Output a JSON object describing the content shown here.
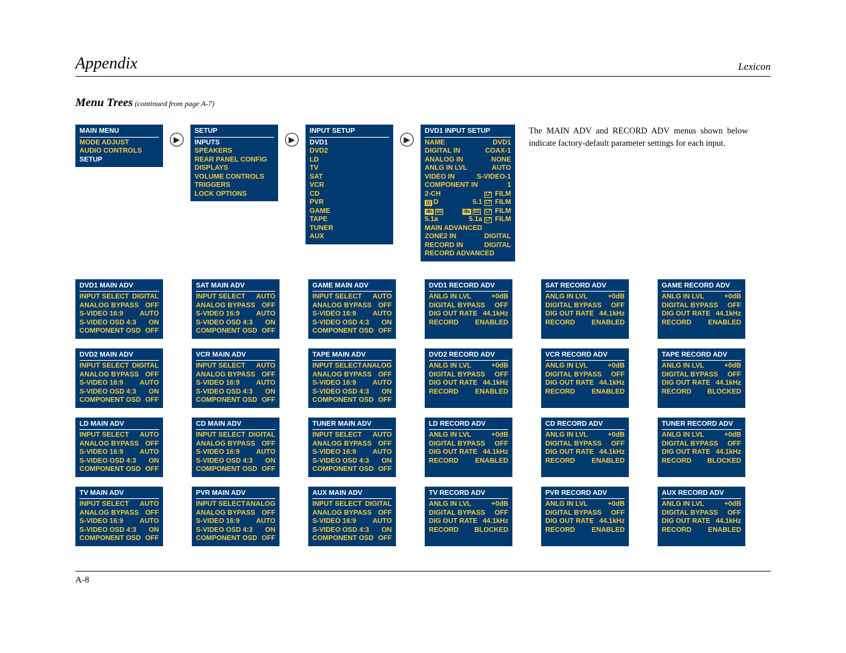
{
  "header": {
    "left": "Appendix",
    "right": "Lexicon",
    "footer": "A-8"
  },
  "subtitle": {
    "main": "Menu Trees",
    "note": "(continued from page A-7)"
  },
  "description": "The MAIN ADV and RECORD ADV menus shown below indicate factory-default parameter settings for each input.",
  "top_boxes": {
    "main_menu": {
      "title": "MAIN MENU",
      "items": [
        "MODE ADJUST",
        "AUDIO CONTROLS"
      ],
      "hdr_items": [
        "SETUP"
      ]
    },
    "setup": {
      "title": "SETUP",
      "items": [
        "SPEAKERS",
        "REAR PANEL CONFIG",
        "DISPLAYS",
        "VOLUME CONTROLS",
        "TRIGGERS",
        "LOCK OPTIONS"
      ],
      "hdr_items": [
        "INPUTS"
      ]
    },
    "input_setup": {
      "title": "INPUT SETUP",
      "items": [
        "DVD2",
        "LD",
        "TV",
        "SAT",
        "VCR",
        "CD",
        "PVR",
        "GAME",
        "TAPE",
        "TUNER",
        "AUX"
      ],
      "hdr_items": [
        "DVD1"
      ]
    },
    "dvd1_input": {
      "title": "DVD1 INPUT SETUP",
      "rows": [
        {
          "l": "NAME",
          "r": "DVD1"
        },
        {
          "l": "DIGITAL IN",
          "r": "COAX-1"
        },
        {
          "l": "ANALOG IN",
          "r": "NONE"
        },
        {
          "l": "ANLG IN LVL",
          "r": "AUTO"
        },
        {
          "l": "VIDEO IN",
          "r": "S-VIDEO-1"
        },
        {
          "l": "COMPONENT IN",
          "r": "1"
        },
        {
          "l": "2-CH",
          "r": "L7 FILM",
          "badge": "L7"
        },
        {
          "l": "DD",
          "r": "5.1 L7 FILM",
          "lbadge": "DD",
          "badge": "L7"
        },
        {
          "l": "dts",
          "r": "dts-ES L7 FILM",
          "lbadge": "dts",
          "badge": "L7"
        },
        {
          "l": "5.1a",
          "r": "5.1a L7 FILM",
          "badge": "L7"
        },
        {
          "l": "MAIN ADVANCED",
          "r": ""
        },
        {
          "l": "ZONE2 IN",
          "r": "DIGITAL"
        },
        {
          "l": "RECORD IN",
          "r": "DIGITAL"
        },
        {
          "l": "RECORD ADVANCED",
          "r": ""
        }
      ]
    }
  },
  "main_adv_rows": [
    {
      "l": "INPUT SELECT",
      "v": [
        "DIGITAL",
        "AUTO",
        "AUTO",
        "DIGITAL",
        "AUTO",
        "ANALOG",
        "AUTO",
        "DIGITAL",
        "AUTO",
        "AUTO",
        "ANALOG",
        "DIGITAL"
      ]
    },
    {
      "l": "ANALOG BYPASS",
      "v": [
        "OFF",
        "OFF",
        "OFF",
        "OFF",
        "OFF",
        "OFF",
        "OFF",
        "OFF",
        "OFF",
        "OFF",
        "OFF",
        "OFF"
      ]
    },
    {
      "l": "S-VIDEO 16:9",
      "v": [
        "AUTO",
        "AUTO",
        "AUTO",
        "AUTO",
        "AUTO",
        "AUTO",
        "AUTO",
        "AUTO",
        "AUTO",
        "AUTO",
        "AUTO",
        "AUTO"
      ]
    },
    {
      "l": "S-VIDEO OSD 4:3",
      "v": [
        "ON",
        "ON",
        "ON",
        "ON",
        "ON",
        "ON",
        "ON",
        "ON",
        "ON",
        "ON",
        "ON",
        "ON"
      ]
    },
    {
      "l": "COMPONENT OSD",
      "v": [
        "OFF",
        "OFF",
        "OFF",
        "OFF",
        "OFF",
        "OFF",
        "OFF",
        "OFF",
        "OFF",
        "OFF",
        "OFF",
        "OFF"
      ]
    }
  ],
  "record_adv_rows": [
    {
      "l": "ANLG IN LVL",
      "v": [
        "+0dB",
        "+0dB",
        "+0dB",
        "+0dB",
        "+0dB",
        "+0dB",
        "+0dB",
        "+0dB",
        "+0dB",
        "+0dB",
        "+0dB",
        "+0dB"
      ]
    },
    {
      "l": "DIGITAL BYPASS",
      "v": [
        "OFF",
        "OFF",
        "OFF",
        "OFF",
        "OFF",
        "OFF",
        "OFF",
        "OFF",
        "OFF",
        "OFF",
        "OFF",
        "OFF"
      ]
    },
    {
      "l": "DIG OUT RATE",
      "v": [
        "44.1kHz",
        "44.1kHz",
        "44.1kHz",
        "44.1kHz",
        "44.1kHz",
        "44.1kHz",
        "44.1kHz",
        "44.1kHz",
        "44.1kHz",
        "44.1kHz",
        "44.1kHz",
        "44.1kHz"
      ]
    },
    {
      "l": "RECORD",
      "v": [
        "ENABLED",
        "ENABLED",
        "ENABLED",
        "ENABLED",
        "ENABLED",
        "BLOCKED",
        "ENABLED",
        "ENABLED",
        "BLOCKED",
        "BLOCKED",
        "ENABLED",
        "ENABLED"
      ]
    }
  ],
  "main_adv_titles": [
    "DVD1 MAIN ADV",
    "SAT MAIN ADV",
    "GAME MAIN ADV",
    "DVD2 MAIN ADV",
    "VCR MAIN ADV",
    "TAPE MAIN ADV",
    "LD MAIN ADV",
    "CD MAIN ADV",
    "TUNER MAIN ADV",
    "TV MAIN ADV",
    "PVR MAIN ADV",
    "AUX MAIN ADV"
  ],
  "record_adv_titles": [
    "DVD1 RECORD ADV",
    "SAT RECORD ADV",
    "GAME RECORD ADV",
    "DVD2 RECORD ADV",
    "VCR RECORD ADV",
    "TAPE RECORD ADV",
    "LD RECORD ADV",
    "CD RECORD ADV",
    "TUNER RECORD ADV",
    "TV RECORD ADV",
    "PVR RECORD ADV",
    "AUX RECORD ADV"
  ],
  "grid_order": [
    0,
    1,
    2,
    0,
    1,
    2,
    3,
    4,
    5,
    3,
    4,
    5,
    6,
    7,
    8,
    6,
    7,
    8,
    9,
    10,
    11,
    9,
    10,
    11
  ],
  "grid_type": [
    "m",
    "m",
    "m",
    "r",
    "r",
    "r",
    "m",
    "m",
    "m",
    "r",
    "r",
    "r",
    "m",
    "m",
    "m",
    "r",
    "r",
    "r",
    "m",
    "m",
    "m",
    "r",
    "r",
    "r"
  ]
}
